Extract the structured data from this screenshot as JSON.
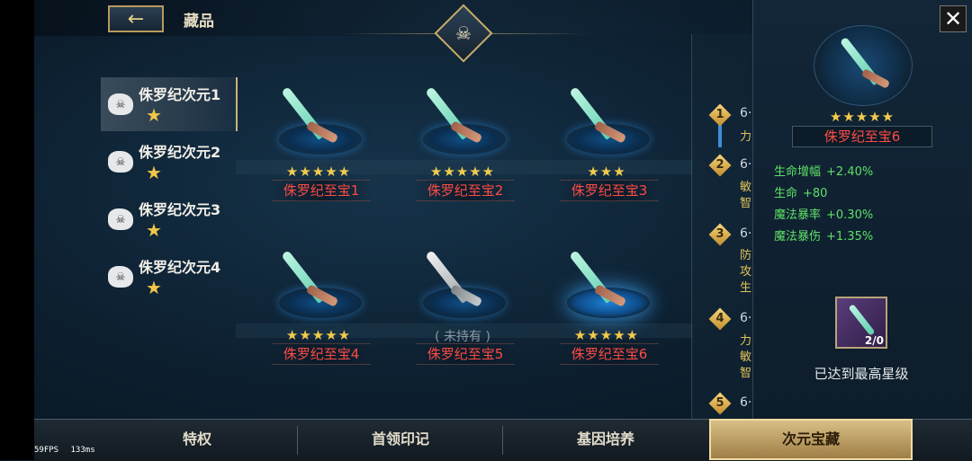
{
  "header": {
    "title": "藏品",
    "back_icon": "←"
  },
  "categories": [
    {
      "label": "侏罗纪次元1",
      "star": "★"
    },
    {
      "label": "侏罗纪次元2",
      "star": "★"
    },
    {
      "label": "侏罗纪次元3",
      "star": "★"
    },
    {
      "label": "侏罗纪次元4",
      "star": "★"
    }
  ],
  "items": [
    {
      "name": "侏罗纪至宝1",
      "stars": "★★★★★"
    },
    {
      "name": "侏罗纪至宝2",
      "stars": "★★★★★"
    },
    {
      "name": "侏罗纪至宝3",
      "stars": "★★★"
    },
    {
      "name": "侏罗纪至宝4",
      "stars": "★★★★★"
    },
    {
      "name": "侏罗纪至宝5",
      "status": "( 未持有 )"
    },
    {
      "name": "侏罗纪至宝6",
      "stars": "★★★★★"
    }
  ],
  "milestones": [
    {
      "num": "1",
      "title": "6·",
      "lines": [
        "力"
      ]
    },
    {
      "num": "2",
      "title": "6·",
      "lines": [
        "敏",
        "智"
      ]
    },
    {
      "num": "3",
      "title": "6·",
      "lines": [
        "防",
        "攻",
        "生"
      ]
    },
    {
      "num": "4",
      "title": "6·",
      "lines": [
        "力",
        "敏",
        "智"
      ]
    },
    {
      "num": "5",
      "title": "6·"
    }
  ],
  "detail": {
    "stars": "★★★★★",
    "name": "侏罗纪至宝6",
    "stats": [
      {
        "label": "生命增幅",
        "value": "+2.40%"
      },
      {
        "label": "生命",
        "value": "+80"
      },
      {
        "label": "魔法暴率",
        "value": "+0.30%"
      },
      {
        "label": "魔法暴伤",
        "value": "+1.35%"
      }
    ],
    "inventory_count": "2/0",
    "max_message": "已达到最高星级",
    "close_icon": "✕"
  },
  "tabs": [
    {
      "label": "特权"
    },
    {
      "label": "首领印记"
    },
    {
      "label": "基因培养"
    },
    {
      "label": "次元宝藏"
    }
  ],
  "debug": {
    "fps": "59FPS",
    "latency": "133ms"
  },
  "colors": {
    "item_name": "#ff4b45",
    "stat": "#5fe067",
    "star": "#f2cb4e",
    "active_tab": "#d8be86"
  }
}
